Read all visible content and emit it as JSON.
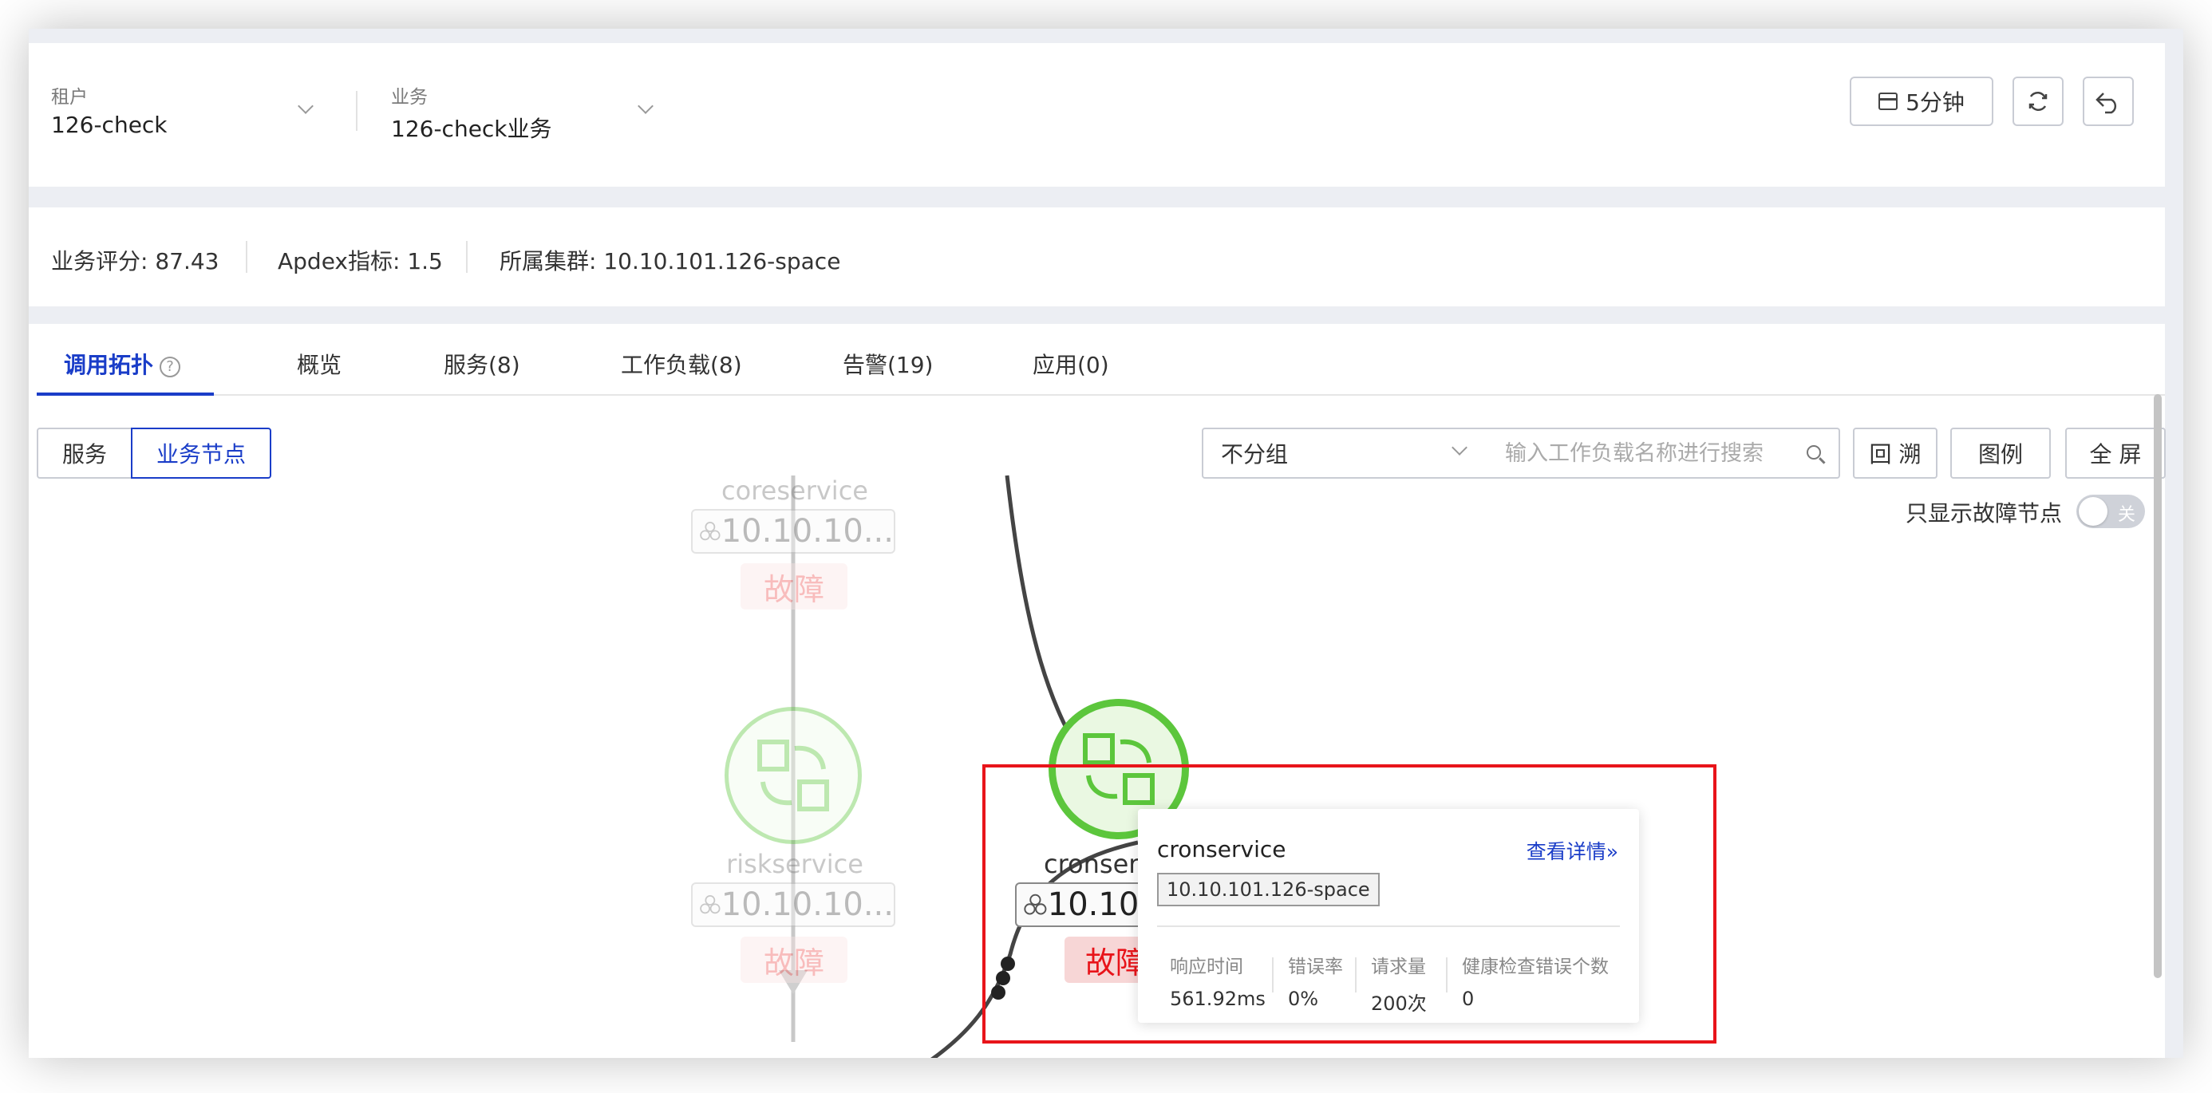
{
  "header": {
    "tenant": {
      "label": "租户",
      "value": "126-check"
    },
    "business": {
      "label": "业务",
      "value": "126-check业务"
    },
    "time_range": "5分钟"
  },
  "info_bar": {
    "score": "业务评分: 87.43",
    "apdex": "Apdex指标: 1.5",
    "cluster": "所属集群: 10.10.101.126-space"
  },
  "tabs": [
    {
      "label": "调用拓扑",
      "active": true
    },
    {
      "label": "概览"
    },
    {
      "label": "服务(8)"
    },
    {
      "label": "工作负载(8)"
    },
    {
      "label": "告警(19)"
    },
    {
      "label": "应用(0)"
    }
  ],
  "view_toggle": {
    "service": "服务",
    "business_node": "业务节点"
  },
  "controls": {
    "group_select": "不分组",
    "search_placeholder": "输入工作负载名称进行搜索",
    "backtrack": "回 溯",
    "legend": "图例",
    "fullscreen": "全 屏",
    "only_fault_label": "只显示故障节点",
    "only_fault_state": "关"
  },
  "nodes": {
    "coreservice": {
      "name": "coreservice",
      "ip": "10.10.10...",
      "status": "故障"
    },
    "riskservice": {
      "name": "riskservice",
      "ip": "10.10.10...",
      "status": "故障"
    },
    "cronservice": {
      "name": "cronser",
      "ip": "10.10.",
      "status": "故障"
    }
  },
  "tooltip": {
    "title": "cronservice",
    "detail_link": "查看详情",
    "cluster_tag": "10.10.101.126-space",
    "metrics": [
      {
        "label": "响应时间",
        "value": "561.92ms"
      },
      {
        "label": "错误率",
        "value": "0%"
      },
      {
        "label": "请求量",
        "value": "200次"
      },
      {
        "label": "健康检查错误个数",
        "value": "0"
      }
    ]
  },
  "colors": {
    "accent": "#1a3dc8",
    "healthy_green": "#5cc63c",
    "fault_red": "#e8141a"
  }
}
